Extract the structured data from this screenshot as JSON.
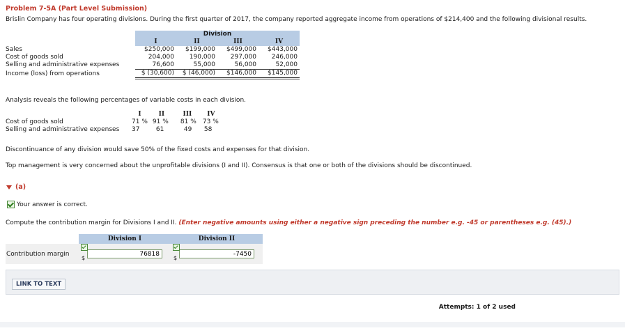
{
  "problem": {
    "title": "Problem 7-5A (Part Level Submission)",
    "intro": "Brislin Company has four operating divisions. During the first quarter of 2017, the company reported aggregate income from operations of $214,400 and the following divisional results."
  },
  "division_table": {
    "group_header": "Division",
    "columns": [
      "I",
      "II",
      "III",
      "IV"
    ],
    "rows": [
      {
        "label": "Sales",
        "values": [
          "$250,000",
          "$199,000",
          "$499,000",
          "$443,000"
        ]
      },
      {
        "label": "Cost of goods sold",
        "values": [
          "204,000",
          "190,000",
          "297,000",
          "246,000"
        ]
      },
      {
        "label": "Selling and administrative expenses",
        "values": [
          "76,600",
          "55,000",
          "56,000",
          "52,000"
        ]
      },
      {
        "label": "Income (loss) from operations",
        "values": [
          "$ (30,600)",
          "$ (46,000)",
          "$146,000",
          "$145,000"
        ]
      }
    ]
  },
  "analysis_text": "Analysis reveals the following percentages of variable costs in each division.",
  "pct_table": {
    "columns": [
      "I",
      "II",
      "III",
      "IV"
    ],
    "rows": [
      {
        "label": "Cost of goods sold",
        "values": [
          "71 %",
          "91 %",
          "81 %",
          "73 %"
        ]
      },
      {
        "label": "Selling and administrative expenses",
        "values": [
          "37",
          "61",
          "49",
          "58"
        ]
      }
    ]
  },
  "discontinuance_text": "Discontinuance of any division would save 50% of the fixed costs and expenses for that division.",
  "top_management_text": "Top management is very concerned about the unprofitable divisions (I and II). Consensus is that one or both of the divisions should be discontinued.",
  "part_a": {
    "label": "(a)",
    "correct_text": "Your answer is correct.",
    "prompt": "Compute the contribution margin for Divisions I and II.",
    "hint": "(Enter negative amounts using either a negative sign preceding the number e.g. -45 or parentheses e.g. (45).)",
    "headers": [
      "Division I",
      "Division II"
    ],
    "row_label": "Contribution margin",
    "currency": "$",
    "answers": [
      "76818",
      "-7450"
    ]
  },
  "link_to_text": "LINK TO TEXT",
  "attempts": "Attempts: 1 of 2 used"
}
